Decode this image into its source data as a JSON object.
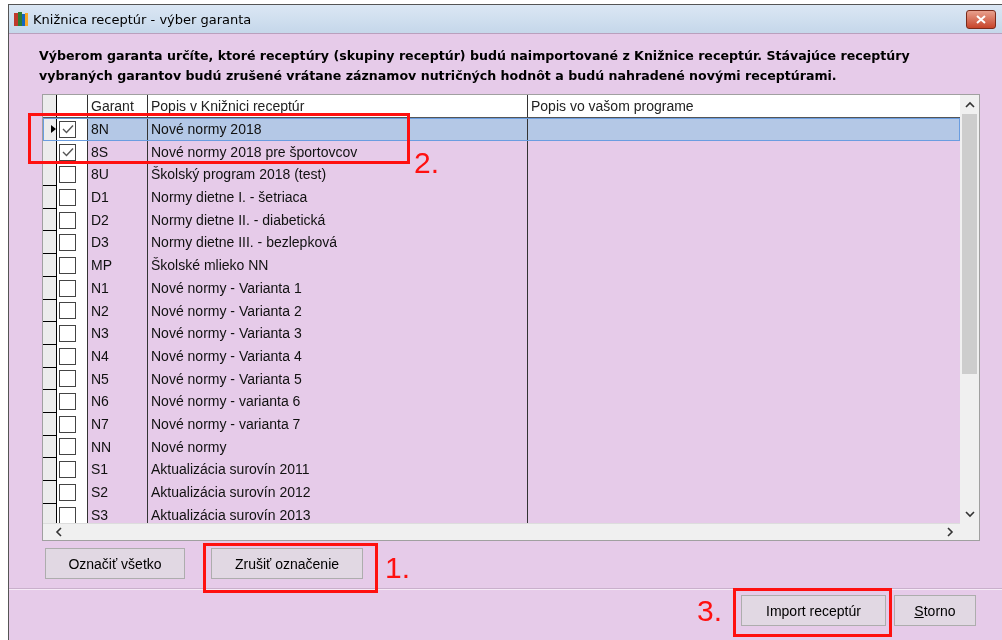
{
  "window": {
    "title": "Knižnica receptúr - výber garanta"
  },
  "description": "Výberom garanta určíte, ktoré receptúry (skupiny receptúr) budú naimportované z Knižnice receptúr. Stávajúce receptúry vybraných garantov budú zrušené vrátane záznamov nutričných hodnôt a budú nahradené novými receptúrami.",
  "table": {
    "columns": [
      "Garant",
      "Popis v Knižnici receptúr",
      "Popis vo vašom programe"
    ],
    "rows": [
      {
        "garant": "8N",
        "popis": "Nové normy 2018",
        "checked": true,
        "selected": true
      },
      {
        "garant": "8S",
        "popis": "Nové normy 2018 pre športovcov",
        "checked": true,
        "selected": false
      },
      {
        "garant": "8U",
        "popis": "Školský program 2018 (test)",
        "checked": false,
        "selected": false
      },
      {
        "garant": "D1",
        "popis": "Normy dietne I. - šetriaca",
        "checked": false,
        "selected": false
      },
      {
        "garant": "D2",
        "popis": "Normy dietne II. - diabetická",
        "checked": false,
        "selected": false
      },
      {
        "garant": "D3",
        "popis": "Normy dietne III. - bezlepková",
        "checked": false,
        "selected": false
      },
      {
        "garant": "MP",
        "popis": "Školské mlieko NN",
        "checked": false,
        "selected": false
      },
      {
        "garant": "N1",
        "popis": "Nové normy - Varianta 1",
        "checked": false,
        "selected": false
      },
      {
        "garant": "N2",
        "popis": "Nové normy - Varianta 2",
        "checked": false,
        "selected": false
      },
      {
        "garant": "N3",
        "popis": "Nové normy - Varianta 3",
        "checked": false,
        "selected": false
      },
      {
        "garant": "N4",
        "popis": "Nové normy - Varianta 4",
        "checked": false,
        "selected": false
      },
      {
        "garant": "N5",
        "popis": "Nové normy - Varianta 5",
        "checked": false,
        "selected": false
      },
      {
        "garant": "N6",
        "popis": "Nové normy - varianta 6",
        "checked": false,
        "selected": false
      },
      {
        "garant": "N7",
        "popis": "Nové normy - varianta 7",
        "checked": false,
        "selected": false
      },
      {
        "garant": "NN",
        "popis": "Nové normy",
        "checked": false,
        "selected": false
      },
      {
        "garant": "S1",
        "popis": "Aktualizácia surovín 2011",
        "checked": false,
        "selected": false
      },
      {
        "garant": "S2",
        "popis": "Aktualizácia surovín 2012",
        "checked": false,
        "selected": false
      },
      {
        "garant": "S3",
        "popis": "Aktualizácia surovín 2013",
        "checked": false,
        "selected": false
      }
    ]
  },
  "selection_buttons": [
    "Označiť všetko",
    "Zrušiť označenie"
  ],
  "dialog_buttons": [
    {
      "label": "Import receptúr"
    },
    {
      "label": "torno",
      "mnemonic": "S"
    }
  ],
  "annotations": [
    {
      "label": "2."
    },
    {
      "label": "1."
    },
    {
      "label": "3."
    }
  ]
}
